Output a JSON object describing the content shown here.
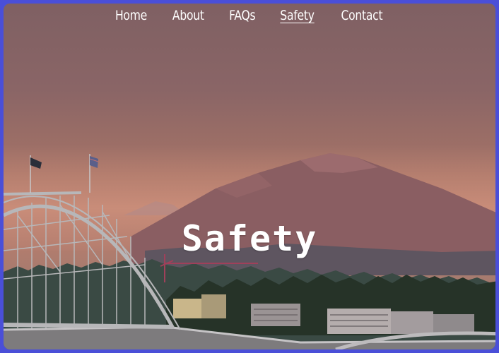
{
  "nav": {
    "items": [
      {
        "label": "Home"
      },
      {
        "label": "About"
      },
      {
        "label": "FAQs"
      },
      {
        "label": "Safety"
      },
      {
        "label": "Contact"
      }
    ],
    "active": "Safety"
  },
  "hero": {
    "title": "Safety"
  },
  "colors": {
    "frame_border": "#4a4fd8",
    "text": "#ffffff",
    "sky_top": "#7f6063",
    "sky_horizon": "#b27c6d",
    "mountain": "#8a5e62",
    "trees": "#263328",
    "bridge": "#b7b7b9"
  }
}
